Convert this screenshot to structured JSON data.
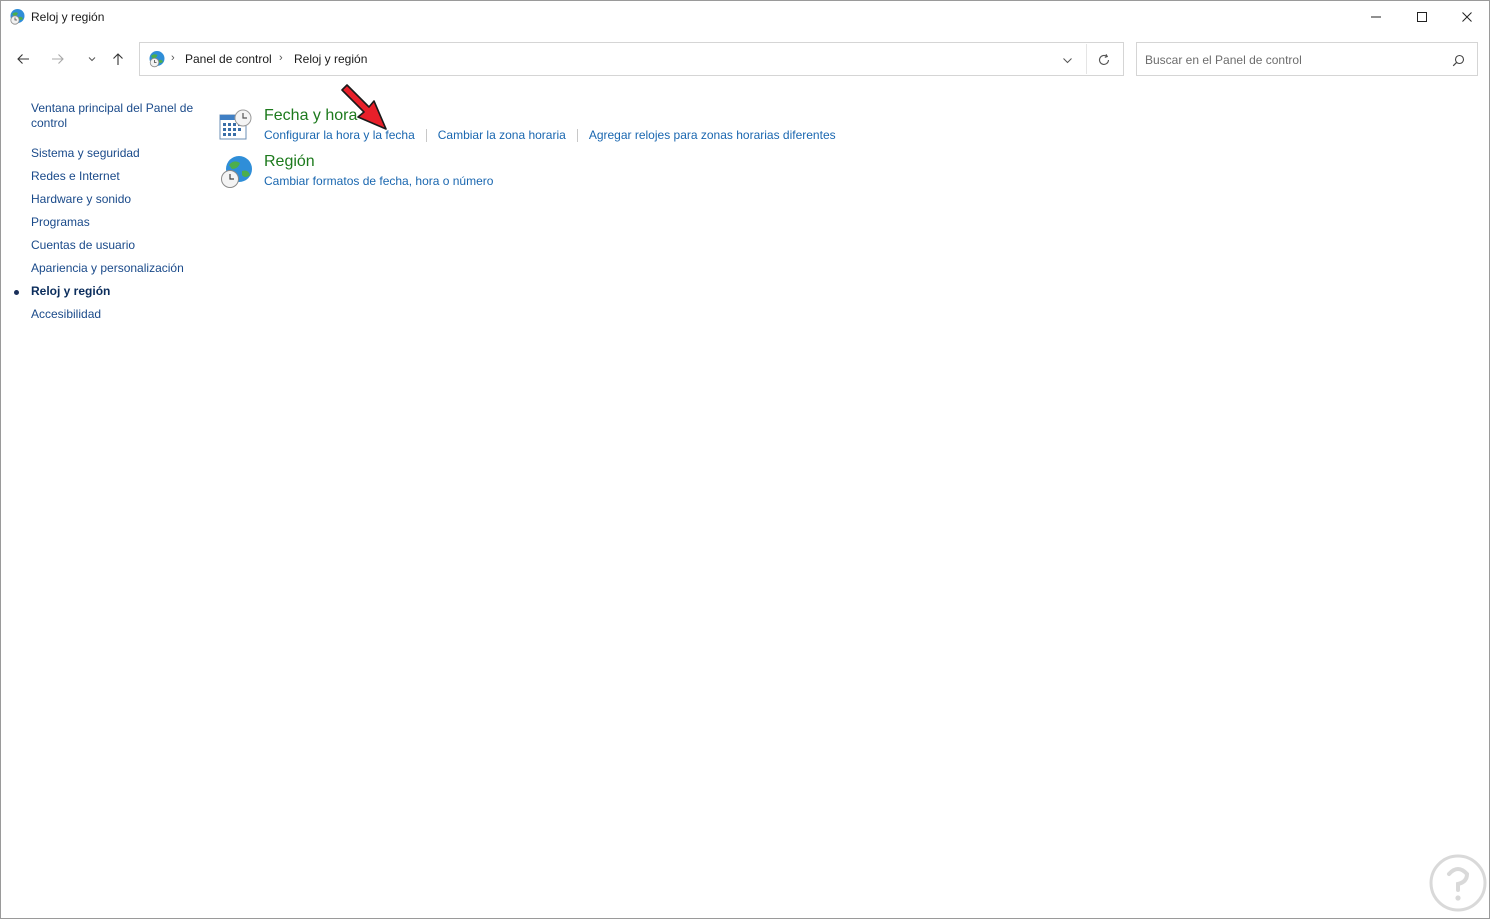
{
  "window": {
    "title": "Reloj y región",
    "controls": {
      "minimize": "minimize-icon",
      "maximize": "maximize-icon",
      "close": "close-icon"
    }
  },
  "navigation": {
    "breadcrumb": [
      "Panel de control",
      "Reloj y región"
    ],
    "search_placeholder": "Buscar en el Panel de control"
  },
  "sidebar": {
    "items": [
      {
        "label": "Ventana principal del Panel de control",
        "current": false
      },
      {
        "label": "Sistema y seguridad",
        "current": false
      },
      {
        "label": "Redes e Internet",
        "current": false
      },
      {
        "label": "Hardware y sonido",
        "current": false
      },
      {
        "label": "Programas",
        "current": false
      },
      {
        "label": "Cuentas de usuario",
        "current": false
      },
      {
        "label": "Apariencia y personalización",
        "current": false
      },
      {
        "label": "Reloj y región",
        "current": true
      },
      {
        "label": "Accesibilidad",
        "current": false
      }
    ]
  },
  "categories": [
    {
      "title": "Fecha y hora",
      "icon": "calendar-clock-icon",
      "links": [
        "Configurar la hora y la fecha",
        "Cambiar la zona horaria",
        "Agregar relojes para zonas horarias diferentes"
      ]
    },
    {
      "title": "Región",
      "icon": "globe-clock-icon",
      "links": [
        "Cambiar formatos de fecha, hora o número"
      ]
    }
  ],
  "colors": {
    "category_title": "#1d7a1d",
    "link": "#1a67b0",
    "sidebar_link": "#1a4a8a",
    "annotation_arrow": "#e8202a"
  }
}
